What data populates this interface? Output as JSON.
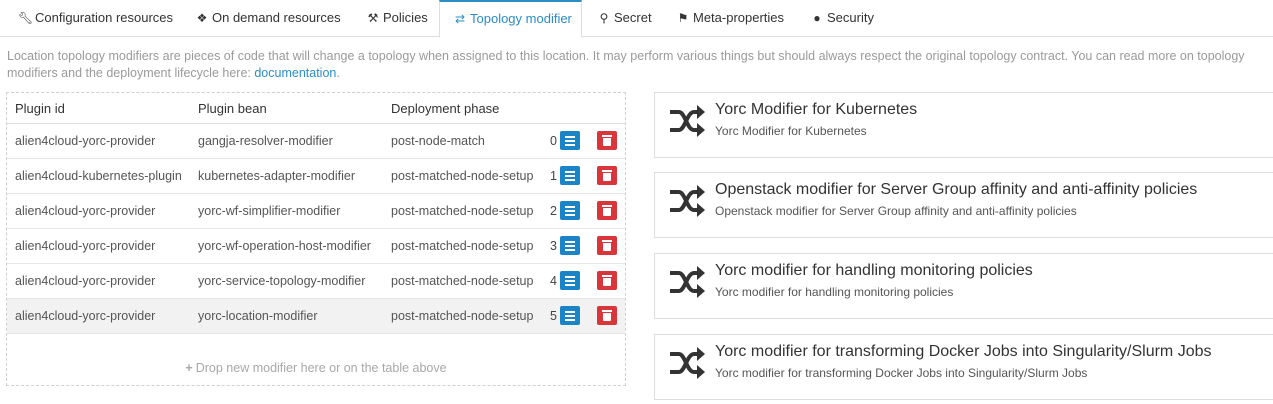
{
  "tabs": [
    {
      "label": "Configuration resources",
      "icon": "wrench-icon",
      "active": false
    },
    {
      "label": "On demand resources",
      "icon": "cubes-icon",
      "active": false
    },
    {
      "label": "Policies",
      "icon": "gavel-icon",
      "active": false
    },
    {
      "label": "Topology modifier",
      "icon": "shuffle-icon",
      "active": true
    },
    {
      "label": "Secret",
      "icon": "key-icon",
      "active": false
    },
    {
      "label": "Meta-properties",
      "icon": "tags-icon",
      "active": false
    },
    {
      "label": "Security",
      "icon": "users-icon",
      "active": false
    }
  ],
  "description": {
    "text": "Location topology modifiers are pieces of code that will change a topology when assigned to this location. It may perform various things but should always respect the original topology contract. You can read more on topology modifiers and the deployment lifecycle here: ",
    "link": "documentation",
    "after": "."
  },
  "table": {
    "headers": [
      "Plugin id",
      "Plugin bean",
      "Deployment phase"
    ],
    "rows": [
      {
        "plugin_id": "alien4cloud-yorc-provider",
        "bean": "gangja-resolver-modifier",
        "phase": "post-node-match",
        "index": "0"
      },
      {
        "plugin_id": "alien4cloud-kubernetes-plugin",
        "bean": "kubernetes-adapter-modifier",
        "phase": "post-matched-node-setup",
        "index": "1"
      },
      {
        "plugin_id": "alien4cloud-yorc-provider",
        "bean": "yorc-wf-simplifier-modifier",
        "phase": "post-matched-node-setup",
        "index": "2"
      },
      {
        "plugin_id": "alien4cloud-yorc-provider",
        "bean": "yorc-wf-operation-host-modifier",
        "phase": "post-matched-node-setup",
        "index": "3"
      },
      {
        "plugin_id": "alien4cloud-yorc-provider",
        "bean": "yorc-service-topology-modifier",
        "phase": "post-matched-node-setup",
        "index": "4"
      },
      {
        "plugin_id": "alien4cloud-yorc-provider",
        "bean": "yorc-location-modifier",
        "phase": "post-matched-node-setup",
        "index": "5"
      }
    ],
    "drop_hint": "Drop new modifier here or on the table above"
  },
  "cards": [
    {
      "title": "Yorc Modifier for Kubernetes",
      "subtitle": "Yorc Modifier for Kubernetes",
      "icon": "shuffle-icon"
    },
    {
      "title": "Openstack modifier for Server Group affinity and anti-affinity policies",
      "subtitle": "Openstack modifier for Server Group affinity and anti-affinity policies",
      "icon": "shuffle-icon"
    },
    {
      "title": "Yorc modifier for handling monitoring policies",
      "subtitle": "Yorc modifier for handling monitoring policies",
      "icon": "shuffle-icon"
    },
    {
      "title": "Yorc modifier for transforming Docker Jobs into Singularity/Slurm Jobs",
      "subtitle": "Yorc modifier for transforming Docker Jobs into Singularity/Slurm Jobs",
      "icon": "shuffle-icon"
    }
  ],
  "colors": {
    "accent": "#2a8dc6",
    "menu_button": "#1a84c6",
    "delete_button": "#d9363c"
  }
}
